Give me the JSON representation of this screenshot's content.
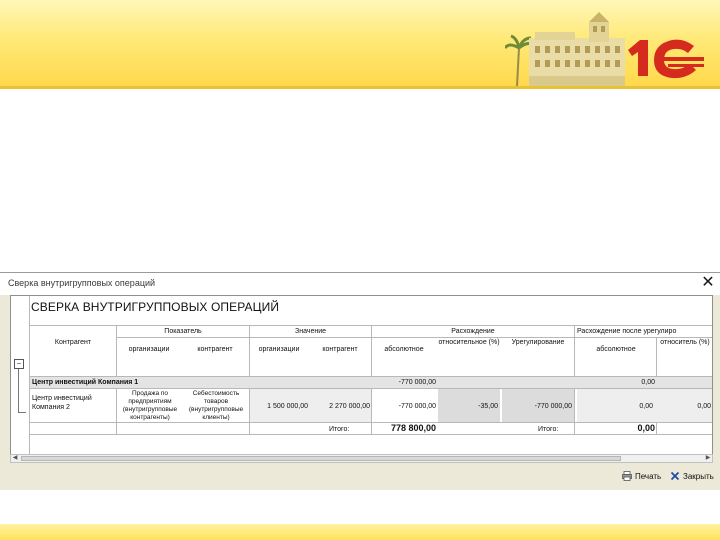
{
  "window": {
    "title": "Сверка внутригрупповых операций",
    "close_glyph": "✕"
  },
  "report": {
    "heading": "СВЕРКА ВНУТРИГРУППОВЫХ ОПЕРАЦИЙ",
    "columns": {
      "counterparty": "Контрагент",
      "indicator": "Показатель",
      "indicator_org": "организации",
      "indicator_cp": "контрагент",
      "value": "Значение",
      "value_org": "организации",
      "value_cp": "контрагент",
      "discrepancy": "Расхождение",
      "discrepancy_abs": "абсолютное",
      "discrepancy_rel": "относительное (%)",
      "settlement": "Урегулирование",
      "after_settlement": "Расхождение после урегулиро",
      "after_abs": "абсолютное",
      "after_rel": "относитель (%)"
    },
    "group": {
      "name": "Центр инвестиций Компания 1",
      "discrepancy": "-770 000,00",
      "after": "0,00"
    },
    "row": {
      "counterparty": "Центр инвестиций Компания 2",
      "indicator_org": "Продажа по предприятиям (внутригрупповые контрагенты)",
      "indicator_cp": "Себестоимость товаров (внутригрупповые клиенты)",
      "value_org": "1 500 000,00",
      "value_cp": "2 270 000,00",
      "disc_abs": "-770 000,00",
      "disc_rel": "-35,00",
      "settlement": "-770 000,00",
      "after_abs": "0,00",
      "after_rel": "0,00"
    },
    "totals": {
      "label1": "Итого:",
      "value1": "778 800,00",
      "label2": "Итого:",
      "value2": "0,00"
    }
  },
  "buttons": {
    "print": "Печать",
    "close": "Закрыть"
  },
  "icons": {
    "expand": "minus-box-icon",
    "print": "printer-icon",
    "close": "close-x-icon"
  },
  "colors": {
    "banner": "#ffe977",
    "logo_red": "#d52b1e",
    "window_bg": "#ece9d8"
  }
}
